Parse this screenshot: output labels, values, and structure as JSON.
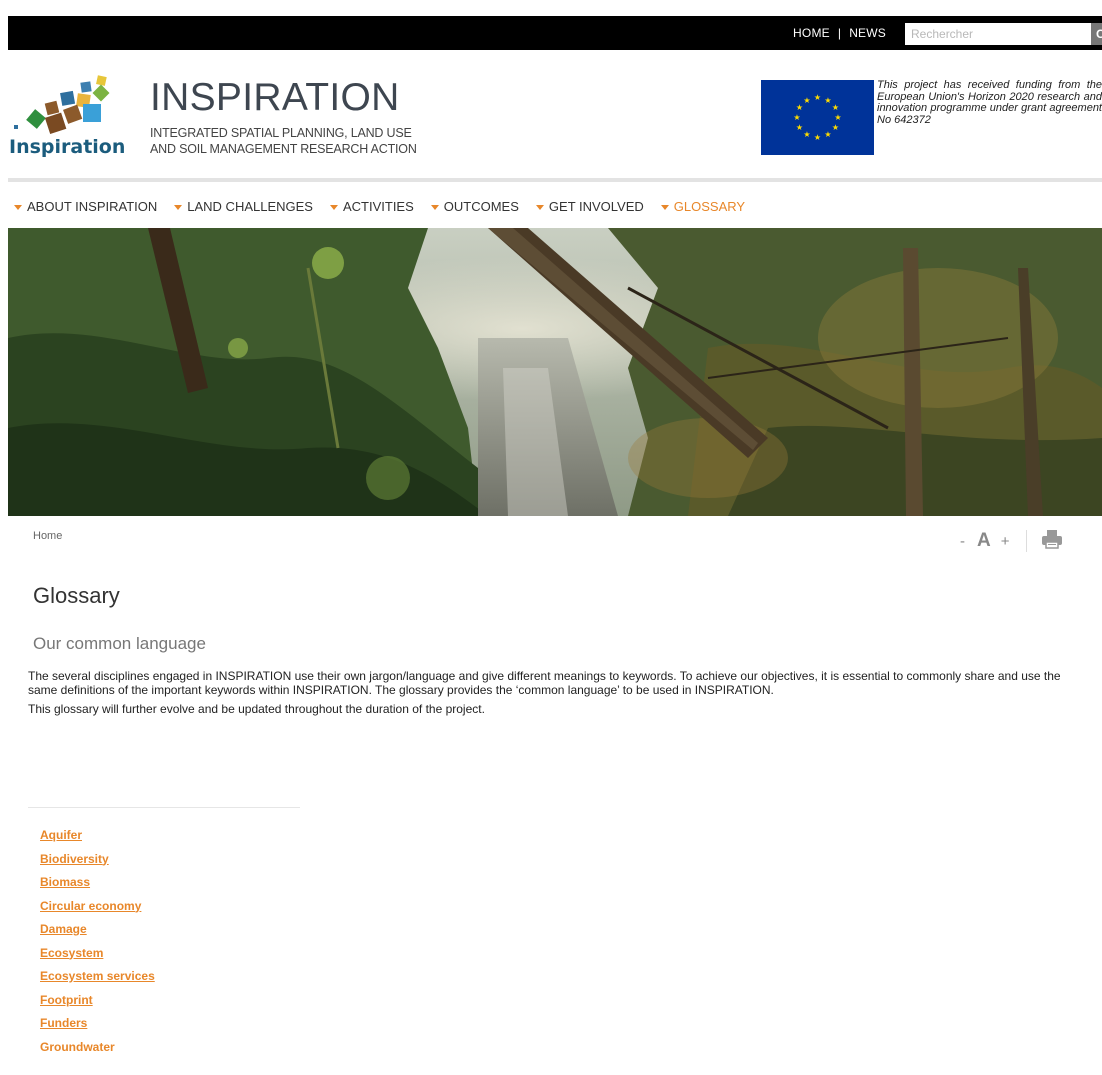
{
  "topbar": {
    "home_label": "HOME",
    "separator": "|",
    "news_label": "NEWS",
    "search_placeholder": "Rechercher",
    "search_button": "OK"
  },
  "header": {
    "logo_word": "Inspiration",
    "title": "INSPIRATION",
    "subtitle_line1": "INTEGRATED SPATIAL PLANNING, LAND USE",
    "subtitle_line2": "AND SOIL MANAGEMENT RESEARCH ACTION",
    "eu_text": "This project has received funding from the European Union's Horizon 2020 research and innovation programme under grant agreement No 642372"
  },
  "nav": {
    "items": [
      {
        "label": "ABOUT INSPIRATION"
      },
      {
        "label": "LAND CHALLENGES"
      },
      {
        "label": "ACTIVITIES"
      },
      {
        "label": "OUTCOMES"
      },
      {
        "label": "GET INVOLVED"
      },
      {
        "label": "GLOSSARY"
      }
    ]
  },
  "breadcrumb": {
    "home": "Home"
  },
  "tools": {
    "decrease": "-",
    "font": "A",
    "increase": "+",
    "print_icon": "printer-icon"
  },
  "content": {
    "title": "Glossary",
    "subtitle": "Our common language",
    "paragraph1": "The several disciplines engaged in INSPIRATION use their own jargon/language and give different meanings to keywords. To achieve our objectives, it is essential to commonly share and use the same definitions of the important keywords within INSPIRATION. The glossary provides the ‘common language’ to be used in INSPIRATION.",
    "paragraph2": "This glossary will further evolve and be updated throughout the duration of the project."
  },
  "glossary": {
    "items": [
      "Aquifer",
      "Biodiversity",
      "Biomass",
      "Circular economy",
      "Damage",
      "Ecosystem",
      "Ecosystem services",
      "Footprint",
      "Funders",
      "Groundwater"
    ]
  },
  "colors": {
    "accent": "#e8872a",
    "topbar": "#000000",
    "eu_blue": "#003399",
    "eu_star": "#ffdd00"
  }
}
